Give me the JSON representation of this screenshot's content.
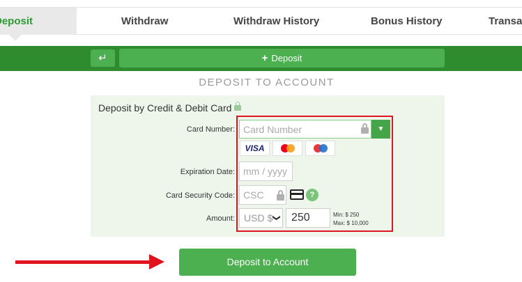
{
  "tabs": [
    {
      "label": "Deposit",
      "active": true
    },
    {
      "label": "Withdraw",
      "active": false
    },
    {
      "label": "Withdraw History",
      "active": false
    },
    {
      "label": "Bonus History",
      "active": false
    },
    {
      "label": "Transac",
      "active": false
    }
  ],
  "actionbar": {
    "back_icon": "↵",
    "deposit_label": "Deposit",
    "plus_icon": "+"
  },
  "section_title": "DEPOSIT TO ACCOUNT",
  "form": {
    "title": "Deposit by Credit & Debit Card",
    "card_number": {
      "label": "Card Number:",
      "placeholder": "Card Number"
    },
    "dropdown_icon": "▼",
    "card_logos": [
      "VISA",
      "mastercard",
      "maestro"
    ],
    "expiration": {
      "label": "Expiration Date:",
      "placeholder": "mm / yyyy"
    },
    "security_code": {
      "label": "Card Security Code:",
      "placeholder": "CSC",
      "help": "?"
    },
    "amount": {
      "label": "Amount:",
      "currency": "USD $",
      "currency_chevron": "❯",
      "value": "250",
      "min": "Min: $ 250",
      "max": "Max: $ 10,000"
    }
  },
  "submit_label": "Deposit to Account",
  "colors": {
    "accent_green": "#4caf50",
    "bar_green": "#2e8b2e",
    "highlight_red": "#e0141e",
    "panel_bg": "#eef6ec"
  }
}
